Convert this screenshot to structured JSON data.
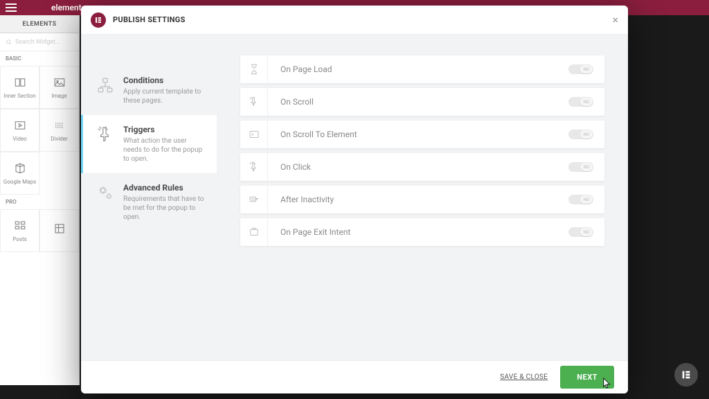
{
  "background": {
    "brand": "elementor",
    "sidebar_header": "ELEMENTS",
    "search_placeholder": "Search Widget...",
    "section_basic": "BASIC",
    "section_pro": "PRO",
    "widgets": [
      "Inner Section",
      "Image",
      "Video",
      "Divider",
      "Google Maps",
      "Posts"
    ]
  },
  "modal": {
    "title": "PUBLISH SETTINGS",
    "nav": {
      "conditions": {
        "title": "Conditions",
        "desc": "Apply current template to these pages."
      },
      "triggers": {
        "title": "Triggers",
        "desc": "What action the user needs to do for the popup to open."
      },
      "advanced": {
        "title": "Advanced Rules",
        "desc": "Requirements that have to be met for the popup to open."
      }
    },
    "triggers": [
      {
        "label": "On Page Load",
        "toggle": "NO"
      },
      {
        "label": "On Scroll",
        "toggle": "NO"
      },
      {
        "label": "On Scroll To Element",
        "toggle": "NO"
      },
      {
        "label": "On Click",
        "toggle": "NO"
      },
      {
        "label": "After Inactivity",
        "toggle": "NO"
      },
      {
        "label": "On Page Exit Intent",
        "toggle": "NO"
      }
    ],
    "footer": {
      "save_close": "SAVE & CLOSE",
      "next": "NEXT"
    }
  }
}
